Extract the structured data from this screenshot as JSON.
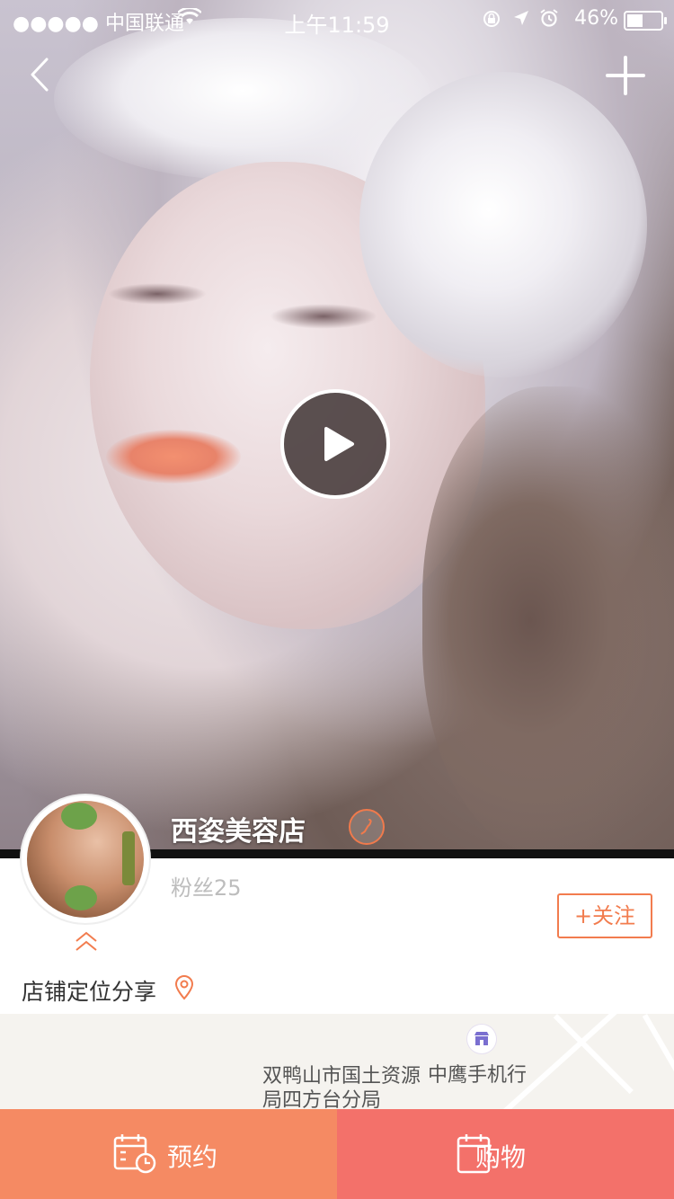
{
  "status_bar": {
    "carrier": "●●●●● 中国联通",
    "time": "上午11:59",
    "battery_text": "46%"
  },
  "nav": {
    "back_icon": "chevron-left-icon",
    "add_icon": "plus-icon"
  },
  "hero": {
    "play_icon": "play-icon"
  },
  "store": {
    "name": "西姿美容店",
    "fans": "粉丝25",
    "follow_label": "+关注",
    "share_label": "店铺定位分享"
  },
  "map": {
    "poi_1": "双鸭山市国土资源局四方台分局",
    "poi_2": "中鹰手机行"
  },
  "tabbar": {
    "book_label": "预约",
    "shop_label": "购物"
  },
  "colors": {
    "accent": "#f27c4e",
    "book_tab": "#f58a63",
    "shop_tab": "#f3716a"
  }
}
